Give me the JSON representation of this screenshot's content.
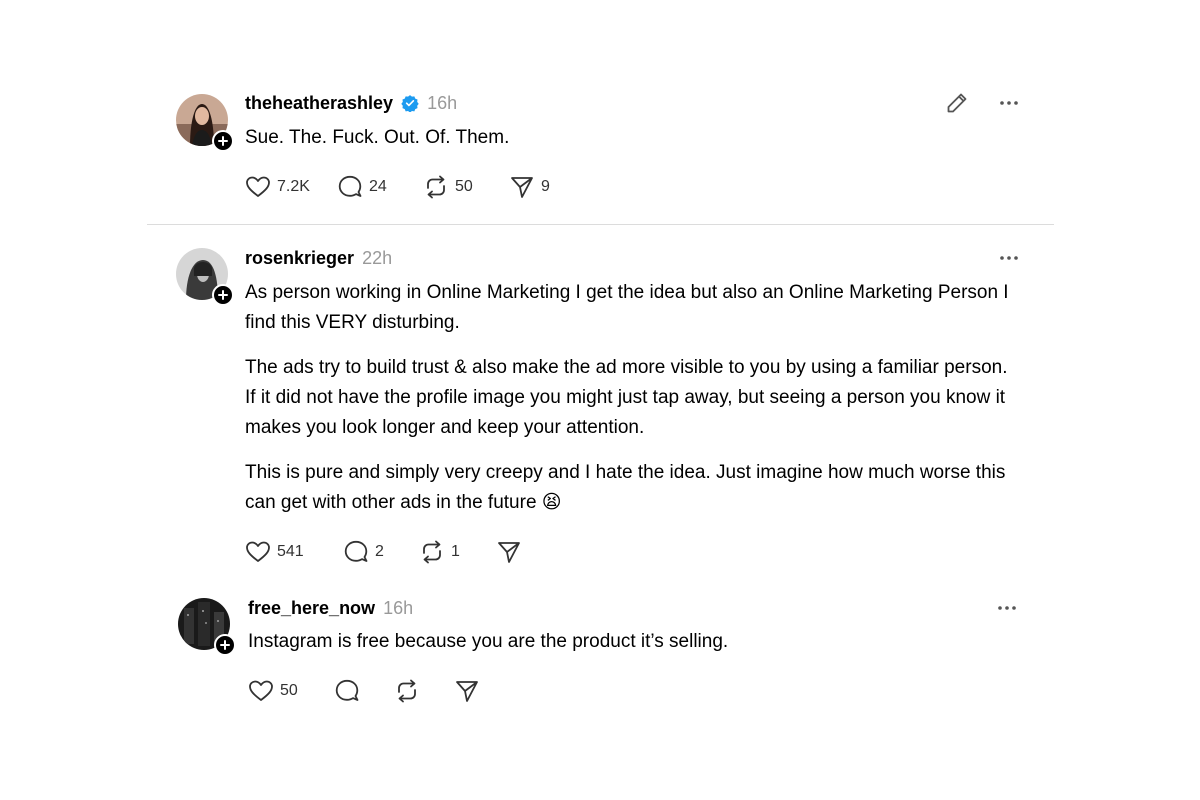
{
  "posts": [
    {
      "username": "theheatherashley",
      "verified": true,
      "time": "16h",
      "paragraphs": [
        "Sue. The. Fuck. Out. Of. Them."
      ],
      "likes": "7.2K",
      "replies": "24",
      "reposts": "50",
      "shares": "9",
      "has_edit": true
    },
    {
      "username": "rosenkrieger",
      "verified": false,
      "time": "22h",
      "paragraphs": [
        "As person working in Online Marketing I get the idea but also an Online Marketing Person I find this VERY disturbing.",
        "The ads try to build trust & also make the ad more visible to you by using a familiar person. If it did not have the profile image you might just tap away, but seeing a person you know it makes you look longer and keep your attention.",
        "This is pure and simply very creepy and I hate the idea. Just imagine how much worse this can get with other ads in the future 😫"
      ],
      "likes": "541",
      "replies": "2",
      "reposts": "1",
      "shares": ""
    },
    {
      "username": "free_here_now",
      "verified": false,
      "time": "16h",
      "paragraphs": [
        "Instagram is free because you are the product it’s selling."
      ],
      "likes": "50",
      "replies": "",
      "reposts": "",
      "shares": ""
    }
  ],
  "icons": {
    "like": "heart-icon",
    "reply": "comment-icon",
    "repost": "repost-icon",
    "share": "send-icon",
    "more": "more-options-icon",
    "edit": "edit-pencil-icon",
    "verified": "verified-badge-icon",
    "follow": "follow-plus-icon"
  },
  "colors": {
    "verified": "#1d9bf0",
    "muted": "#999999",
    "divider": "#dcdcdc"
  }
}
